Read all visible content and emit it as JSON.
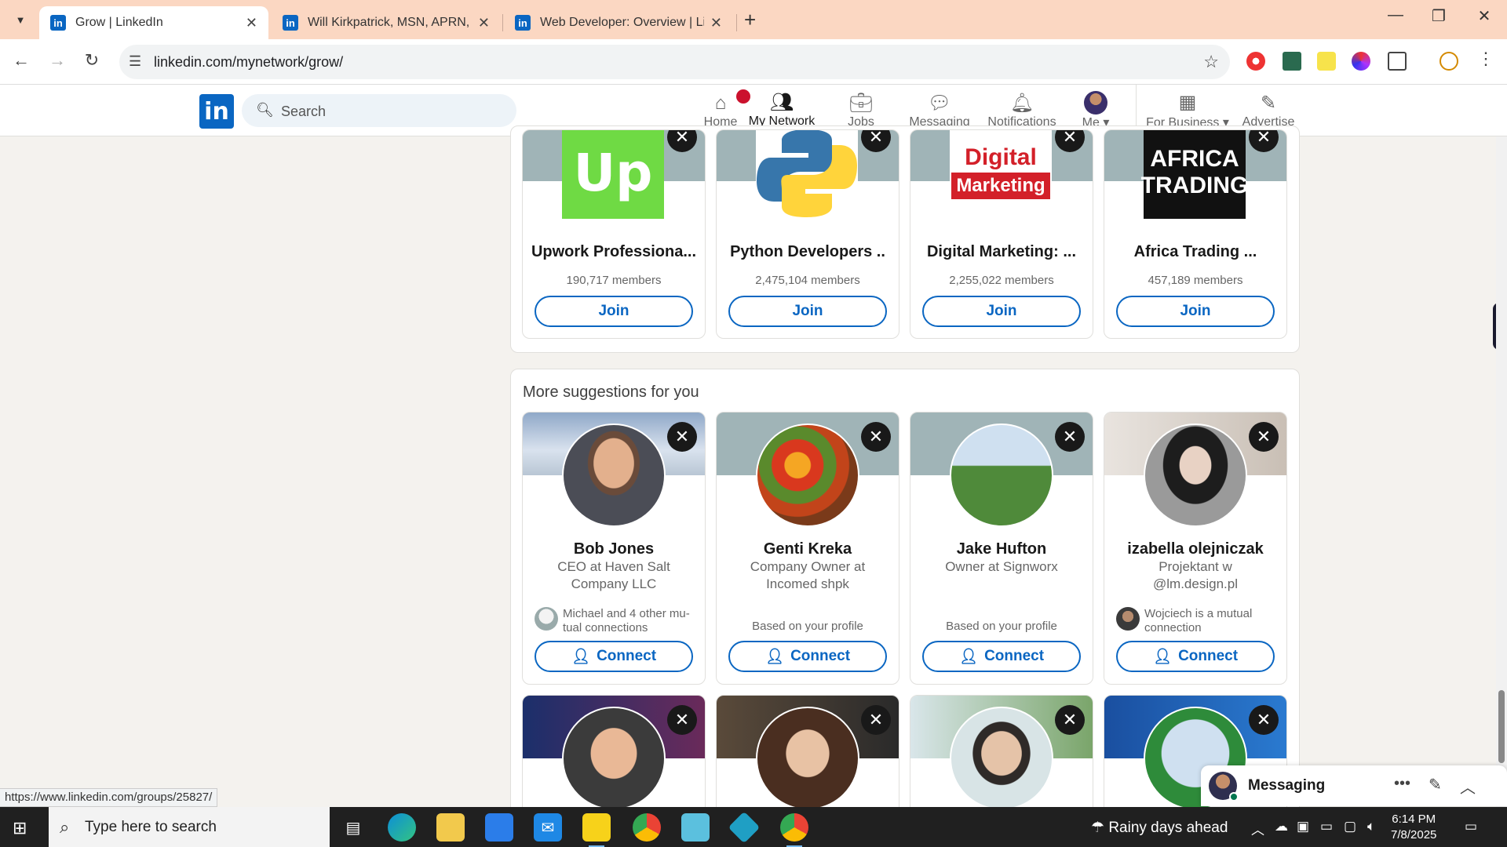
{
  "browser": {
    "tabs": [
      {
        "title": "Grow | LinkedIn",
        "active": true
      },
      {
        "title": "Will Kirkpatrick, MSN, APRN, FN",
        "active": false
      },
      {
        "title": "Web Developer: Overview | Link",
        "active": false
      }
    ],
    "url": "linkedin.com/mynetwork/grow/",
    "status_url": "https://www.linkedin.com/groups/25827/"
  },
  "header": {
    "logo": "in",
    "search_placeholder": "Search",
    "nav": [
      {
        "label": "Home",
        "icon": "home-icon",
        "badge": "•"
      },
      {
        "label": "My Network",
        "icon": "people-icon"
      },
      {
        "label": "Jobs",
        "icon": "briefcase-icon"
      },
      {
        "label": "Messaging",
        "icon": "chat-icon"
      },
      {
        "label": "Notifications",
        "icon": "bell-icon"
      },
      {
        "label": "Me",
        "icon": "avatar"
      },
      {
        "label": "For Business",
        "icon": "grid-icon"
      },
      {
        "label": "Advertise",
        "icon": "advertise-icon"
      }
    ]
  },
  "groups": [
    {
      "name": "Upwork Professiona...",
      "members": "190,717 members",
      "button": "Join",
      "logo_text": "Up",
      "logo_color": "#6fda44"
    },
    {
      "name": "Python Developers ..",
      "members": "2,475,104 members",
      "button": "Join",
      "logo_text": "Py",
      "logo_color": "#3776ab"
    },
    {
      "name": "Digital Marketing: ...",
      "members": "2,255,022 members",
      "button": "Join",
      "logo_text": "Digital Marketing",
      "logo_color": "#d32029"
    },
    {
      "name": "Africa Trading ...",
      "members": "457,189 members",
      "button": "Join",
      "logo_text": "AFRICA TRADING",
      "logo_color": "#111111"
    }
  ],
  "suggestions": {
    "title": "More suggestions for you",
    "people": [
      {
        "name": "Bob Jones",
        "headline": "CEO at Haven Salt Company LLC",
        "meta": "Michael and 4 other mu-tual connections",
        "button": "Connect"
      },
      {
        "name": "Genti Kreka",
        "headline": "Company Owner at Incomed shpk",
        "meta": "Based on your profile",
        "button": "Connect"
      },
      {
        "name": "Jake Hufton",
        "headline": "Owner at Signworx",
        "meta": "Based on your profile",
        "button": "Connect"
      },
      {
        "name": "izabella olejniczak",
        "headline": "Projektant w @lm.design.pl",
        "meta": "Wojciech is a mutual connection",
        "button": "Connect"
      }
    ]
  },
  "messaging": {
    "label": "Messaging"
  },
  "taskbar": {
    "search_placeholder": "Type here to search",
    "weather": "Rainy days ahead",
    "time": "6:14 PM",
    "date": "7/8/2025"
  },
  "colors": {
    "linkedin_blue": "#0a66c2",
    "tabbar": "#fbd7c2"
  }
}
